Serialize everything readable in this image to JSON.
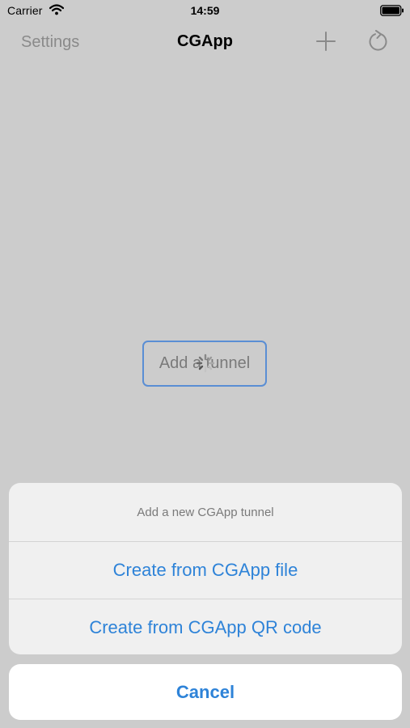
{
  "status_bar": {
    "carrier": "Carrier",
    "time": "14:59",
    "icons": [
      "wifi-icon",
      "battery-icon"
    ]
  },
  "nav": {
    "left_label": "Settings",
    "title": "CGApp",
    "icons": [
      "add-icon",
      "refresh-icon"
    ]
  },
  "main": {
    "add_tunnel_label": "Add a tunnel",
    "activity_icon": "spinner-icon"
  },
  "action_sheet": {
    "header": "Add a new CGApp tunnel",
    "items": [
      {
        "label": "Create from CGApp file"
      },
      {
        "label": "Create from CGApp QR code"
      }
    ],
    "cancel_label": "Cancel"
  },
  "colors": {
    "dim_background": "#cccccc",
    "accent": "#2e83d8",
    "sheet_background": "#f0f0f0",
    "tunnel_button_border": "#5a8ed4"
  }
}
